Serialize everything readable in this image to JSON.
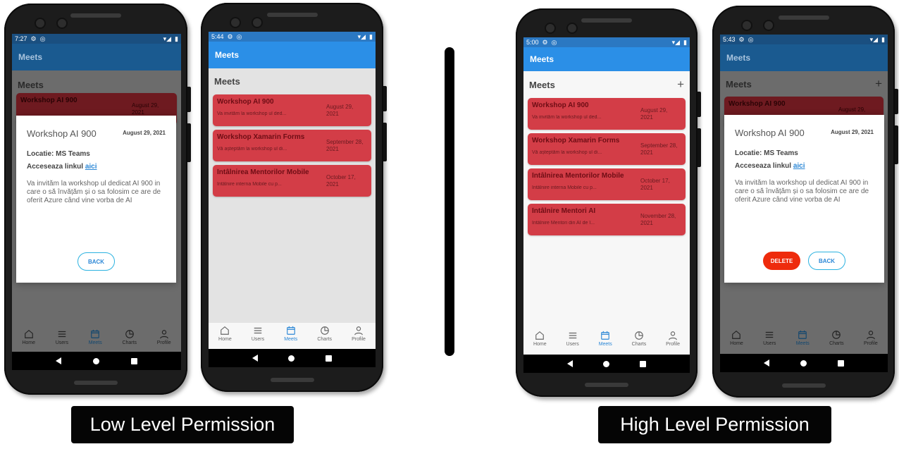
{
  "captions": {
    "low": "Low Level Permission",
    "high": "High Level Permission"
  },
  "colors": {
    "appbar_blue": "#2b8fe7",
    "card_red": "#d33d47",
    "delete_red": "#ee2b0c",
    "active_tab": "#2b87d6"
  },
  "tabs": [
    {
      "label": "Home",
      "icon": "home-icon"
    },
    {
      "label": "Users",
      "icon": "list-icon"
    },
    {
      "label": "Meets",
      "icon": "calendar-icon"
    },
    {
      "label": "Charts",
      "icon": "pie-chart-icon"
    },
    {
      "label": "Profile",
      "icon": "person-icon"
    }
  ],
  "phone1": {
    "time": "7:27",
    "app_title": "Meets",
    "page_title": "Meets",
    "behind_card": {
      "title": "Workshop AI 900",
      "date": "August 29, 2021"
    },
    "modal": {
      "title": "Workshop AI 900",
      "date": "August 29, 2021",
      "location": "Locatie: MS Teams",
      "link_prefix": "Acceseaza linkul",
      "link_text": "aici",
      "description": "Va invităm la workshop ul dedicat AI 900 in care o să învățăm și o sa folosim ce are de oferit Azure când vine vorba de AI",
      "back": "BACK"
    }
  },
  "phone2": {
    "time": "5:44",
    "app_title": "Meets",
    "page_title": "Meets",
    "cards": [
      {
        "title": "Workshop AI 900",
        "date": "August 29, 2021",
        "summary": "Va invităm la workshop ul ded..."
      },
      {
        "title": "Workshop Xamarin Forms",
        "date": "September 28, 2021",
        "summary": "Vă așteptăm la workshop ul di..."
      },
      {
        "title": "Întâlnirea Mentorilor Mobile",
        "date": "October 17, 2021",
        "summary": "Întâlnire interna Mobile cu p..."
      }
    ]
  },
  "phone3": {
    "time": "5:00",
    "app_title": "Meets",
    "page_title": "Meets",
    "add": "+",
    "cards": [
      {
        "title": "Workshop AI 900",
        "date": "August 29, 2021",
        "summary": "Va invităm la workshop ul ded..."
      },
      {
        "title": "Workshop Xamarin Forms",
        "date": "September 28, 2021",
        "summary": "Vă așteptăm la workshop ul di..."
      },
      {
        "title": "Întâlnirea Mentorilor Mobile",
        "date": "October 17, 2021",
        "summary": "Întâlnire interna Mobile cu p..."
      },
      {
        "title": "Întâlnire Mentori AI",
        "date": "November 28, 2021",
        "summary": "Întâlnire Mentori din AI de î..."
      }
    ]
  },
  "phone4": {
    "time": "5:43",
    "app_title": "Meets",
    "page_title": "Meets",
    "add": "+",
    "behind_card": {
      "title": "Workshop AI 900",
      "date": "August 29,"
    },
    "modal": {
      "title": "Workshop AI 900",
      "date": "August 29, 2021",
      "location": "Locatie: MS Teams",
      "link_prefix": "Acceseaza linkul",
      "link_text": "aici",
      "description": "Va invităm la workshop ul dedicat AI 900 in care o să învățăm și o sa folosim ce are de oferit Azure când vine vorba de AI",
      "delete": "DELETE",
      "back": "BACK"
    }
  }
}
